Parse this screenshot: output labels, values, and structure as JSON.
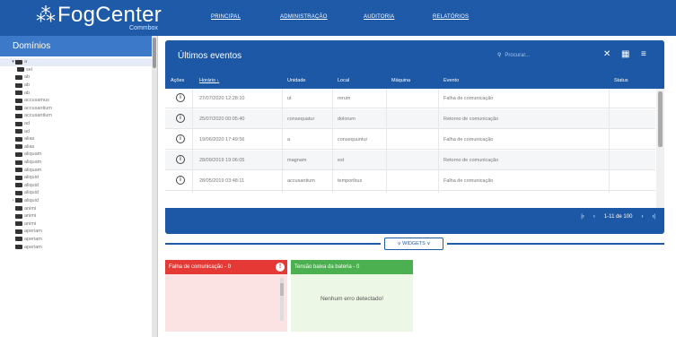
{
  "brand": {
    "mark": "⁂",
    "name": "FogCenter",
    "sub": "Commbox"
  },
  "nav": [
    "PRINCIPAL",
    "ADMINISTRAÇÃO",
    "AUDITORIA",
    "RELATÓRIOS"
  ],
  "sidebar": {
    "title": "Domínios",
    "nodes": [
      {
        "label": "a",
        "expand": "▾"
      },
      {
        "label": "sel",
        "expand": ""
      },
      {
        "label": "ab",
        "expand": ""
      },
      {
        "label": "ab",
        "expand": ""
      },
      {
        "label": "ab",
        "expand": ""
      },
      {
        "label": "accusamus",
        "expand": ""
      },
      {
        "label": "accusantium",
        "expand": ""
      },
      {
        "label": "accusantium",
        "expand": ""
      },
      {
        "label": "ad",
        "expand": ""
      },
      {
        "label": "ad",
        "expand": ""
      },
      {
        "label": "alias",
        "expand": ""
      },
      {
        "label": "alias",
        "expand": ""
      },
      {
        "label": "aliquam",
        "expand": ""
      },
      {
        "label": "aliquam",
        "expand": ""
      },
      {
        "label": "aliquam",
        "expand": ""
      },
      {
        "label": "aliquid",
        "expand": ""
      },
      {
        "label": "aliquid",
        "expand": ""
      },
      {
        "label": "aliquid",
        "expand": ""
      },
      {
        "label": "aliquid",
        "expand": "›"
      },
      {
        "label": "animi",
        "expand": ""
      },
      {
        "label": "animi",
        "expand": ""
      },
      {
        "label": "animi",
        "expand": ""
      },
      {
        "label": "aperiam",
        "expand": ""
      },
      {
        "label": "aperiam",
        "expand": ""
      },
      {
        "label": "aperiam",
        "expand": ""
      }
    ]
  },
  "events": {
    "title": "Últimos eventos",
    "search_placeholder": "Procurar...",
    "search_icon": "⚲",
    "columns": [
      "Ações",
      "Horário ↓",
      "Unidade",
      "Local",
      "Máquina",
      "Evento",
      "Status"
    ],
    "rows": [
      {
        "time": "27/07/2020 12:28:10",
        "unit": "ut",
        "local": "rerum",
        "machine": "",
        "event": "Falha de comunicação",
        "status": ""
      },
      {
        "time": "25/07/2020 00:05:40",
        "unit": "consequatur",
        "local": "dolorum",
        "machine": "",
        "event": "Retorno de comunicação",
        "status": ""
      },
      {
        "time": "19/06/2020 17:49:56",
        "unit": "a",
        "local": "consequuntur",
        "machine": "",
        "event": "Falha de comunicação",
        "status": ""
      },
      {
        "time": "28/09/2019 19:06:05",
        "unit": "magnam",
        "local": "est",
        "machine": "",
        "event": "Retorno de comunicação",
        "status": ""
      },
      {
        "time": "28/05/2019 03:48:11",
        "unit": "accusantium",
        "local": "temporibus",
        "machine": "",
        "event": "Falha de comunicação",
        "status": ""
      }
    ],
    "icons": {
      "clear": "✕",
      "columns": "▦",
      "filter": "≡"
    },
    "pager": {
      "first": "|‹",
      "prev": "‹",
      "range": "1-11 de 100",
      "next": "›",
      "last": "›|"
    }
  },
  "widgets": {
    "toggle_label": "∨ WIDGETS ∨",
    "battery_fail_title": "Falha de comunicação - 0",
    "battery_fail_close": "!",
    "battery_low_title": "Tensão baixa da bateria - 0",
    "battery_low_message": "Nenhum erro detectado!"
  },
  "colors": {
    "primary": "#1e5aa8",
    "sidebar_head": "#3d79c9",
    "alert": "#e53935",
    "ok": "#4caf50"
  }
}
